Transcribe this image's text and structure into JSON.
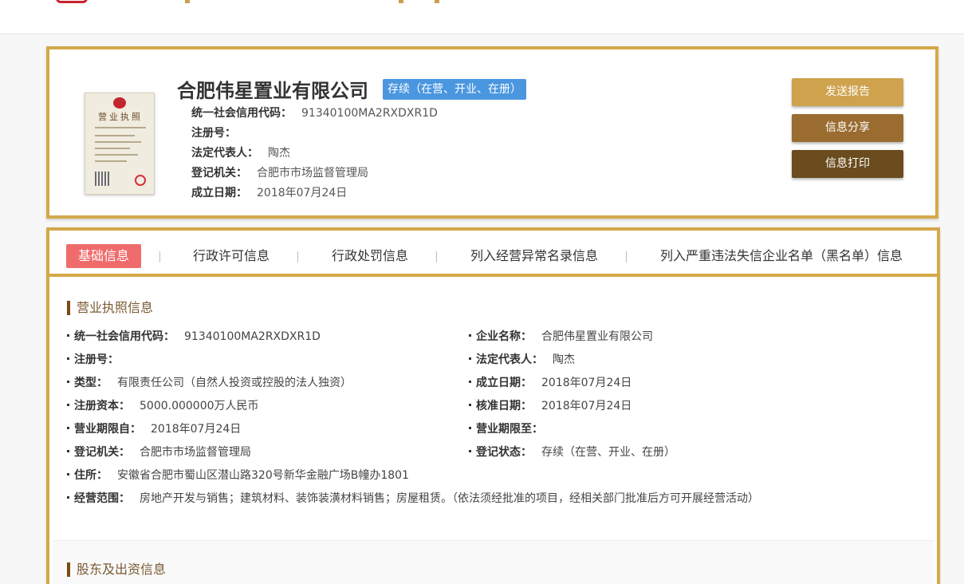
{
  "company": {
    "name": "合肥伟星置业有限公司",
    "status": "存续（在营、开业、在册）",
    "license_title": "营业执照",
    "summary": [
      {
        "label": "统一社会信用代码：",
        "value": "91340100MA2RXDXR1D"
      },
      {
        "label": "注册号：",
        "value": ""
      },
      {
        "label": "法定代表人：",
        "value": "陶杰"
      },
      {
        "label": "登记机关：",
        "value": "合肥市市场监督管理局"
      },
      {
        "label": "成立日期：",
        "value": "2018年07月24日"
      }
    ]
  },
  "actions": {
    "send_report": "发送报告",
    "share_info": "信息分享",
    "print_info": "信息打印"
  },
  "tabs": [
    {
      "label": "基础信息",
      "active": true
    },
    {
      "label": "行政许可信息",
      "active": false
    },
    {
      "label": "行政处罚信息",
      "active": false
    },
    {
      "label": "列入经营异常名录信息",
      "active": false
    },
    {
      "label": "列入严重违法失信企业名单（黑名单）信息",
      "active": false
    }
  ],
  "license_section": {
    "title": "营业执照信息",
    "left": [
      {
        "label": "统一社会信用代码：",
        "value": "91340100MA2RXDXR1D"
      },
      {
        "label": "注册号：",
        "value": ""
      },
      {
        "label": "类型：",
        "value": "有限责任公司（自然人投资或控股的法人独资）"
      },
      {
        "label": "注册资本：",
        "value": "5000.000000万人民币"
      },
      {
        "label": "营业期限自：",
        "value": "2018年07月24日"
      },
      {
        "label": "登记机关：",
        "value": "合肥市市场监督管理局"
      },
      {
        "label": "住所：",
        "value": "安徽省合肥市蜀山区潜山路320号新华金融广场B幢办1801"
      },
      {
        "label": "经营范围：",
        "value": "房地产开发与销售；建筑材料、装饰装潢材料销售；房屋租赁。（依法须经批准的项目，经相关部门批准后方可开展经营活动）"
      }
    ],
    "right": [
      {
        "label": "企业名称：",
        "value": "合肥伟星置业有限公司"
      },
      {
        "label": "法定代表人：",
        "value": "陶杰"
      },
      {
        "label": "成立日期：",
        "value": "2018年07月24日"
      },
      {
        "label": "核准日期：",
        "value": "2018年07月24日"
      },
      {
        "label": "营业期限至：",
        "value": ""
      },
      {
        "label": "登记状态：",
        "value": "存续（在营、开业、在册）"
      }
    ]
  },
  "shareholder_section": {
    "title": "股东及出资信息"
  },
  "colors": {
    "accent_gold": "#d3a94a",
    "status_blue": "#4a97e0",
    "active_tab": "#f06c6c",
    "btn_send": "#cfa24d",
    "btn_share": "#9a6c30",
    "btn_print": "#6a4c1e"
  }
}
